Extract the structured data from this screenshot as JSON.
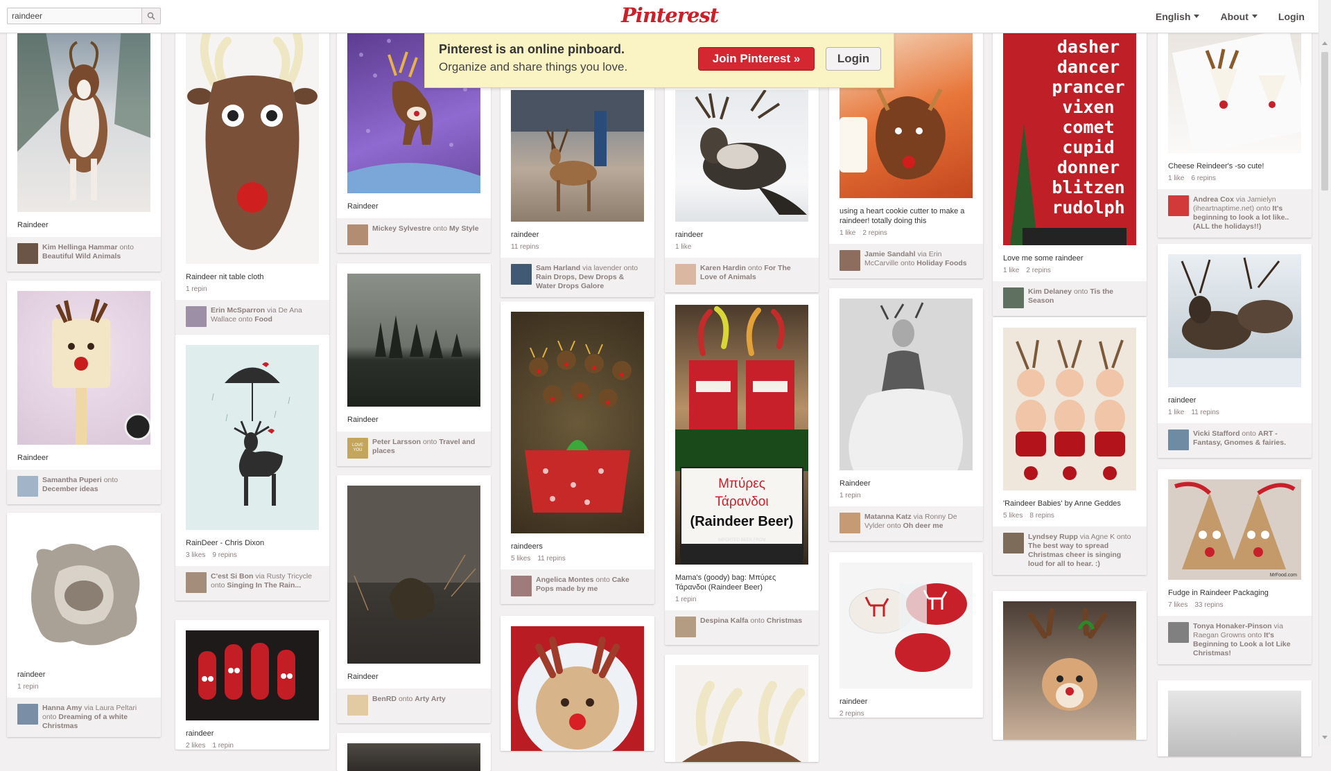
{
  "header": {
    "search_value": "raindeer",
    "logo": "Pinterest",
    "nav": [
      {
        "label": "English"
      },
      {
        "label": "About"
      },
      {
        "label": "Login"
      }
    ]
  },
  "banner": {
    "title": "Pinterest is an online pinboard.",
    "subtitle": "Organize and share things you love.",
    "join_label": "Join Pinterest »",
    "login_label": "Login"
  },
  "pins": [
    {
      "desc": "Raindeer",
      "stats": [],
      "user": "Kim Hellinga Hammar",
      "via": "",
      "onto_word": "onto",
      "board": "Beautiful Wild Animals"
    },
    {
      "desc": "Raindeer nit table cloth",
      "stats": [
        "1 repin"
      ],
      "user": "Erin McSparron",
      "via": "via De Ana Wallace",
      "onto_word": "onto",
      "board": "Food"
    },
    {
      "desc": "Raindeer",
      "stats": [],
      "user": "Mickey Sylvestre",
      "via": "",
      "onto_word": "onto",
      "board": "My Style"
    },
    {
      "desc": "raindeer",
      "stats": [
        "11 repins"
      ],
      "user": "Sam Harland",
      "via": "via lavender",
      "onto_word": "onto",
      "board": "Rain Drops, Dew Drops & Water Drops Galore"
    },
    {
      "desc": "raindeer",
      "stats": [
        "1 like"
      ],
      "user": "Karen Hardin",
      "via": "",
      "onto_word": "onto",
      "board": "For The Love of Animals"
    },
    {
      "desc": "using a heart cookie cutter to make a raindeer! totally doing this",
      "stats": [
        "1 like",
        "2 repins"
      ],
      "user": "Jamie Sandahl",
      "via": "via Erin McCarville",
      "onto_word": "onto",
      "board": "Holiday Foods"
    },
    {
      "desc": "Love me some raindeer",
      "stats": [
        "1 like",
        "2 repins"
      ],
      "user": "Kim Delaney",
      "via": "",
      "onto_word": "onto",
      "board": "Tis the Season"
    },
    {
      "desc": "Cheese Reindeer's -so cute!",
      "stats": [
        "1 like",
        "6 repins"
      ],
      "user": "Andrea Cox",
      "via": "via Jamielyn (iheartnaptime.net)",
      "onto_word": "onto",
      "board": "It's beginning to look a lot like.. (ALL the holidays!!)"
    },
    {
      "desc": "Raindeer",
      "stats": [],
      "user": "Samantha Puperi",
      "via": "",
      "onto_word": "onto",
      "board": "December ideas"
    },
    {
      "desc": "RainDeer - Chris Dixon",
      "stats": [
        "3 likes",
        "9 repins"
      ],
      "user": "C'est Si Bon",
      "via": "via Rusty Tricycle",
      "onto_word": "onto",
      "board": "Singing In The Rain..."
    },
    {
      "desc": "Raindeer",
      "stats": [],
      "user": "Peter Larsson",
      "via": "",
      "onto_word": "onto",
      "board": "Travel and places"
    },
    {
      "desc": "raindeers",
      "stats": [
        "5 likes",
        "11 repins"
      ],
      "user": "Angelica Montes",
      "via": "",
      "onto_word": "onto",
      "board": "Cake Pops made by me"
    },
    {
      "desc": "Mama's (goody) bag: Μπύρες Τάρανδοι (Raindeer Beer)",
      "stats": [
        "1 repin"
      ],
      "user": "Despina Kalfa",
      "via": "",
      "onto_word": "onto",
      "board": "Christmas"
    },
    {
      "desc": "Raindeer",
      "stats": [
        "1 repin"
      ],
      "user": "Matanna Katz",
      "via": "via Ronny De Vylder",
      "onto_word": "onto",
      "board": "Oh deer me"
    },
    {
      "desc": "'Raindeer Babies' by Anne Geddes",
      "stats": [
        "5 likes",
        "8 repins"
      ],
      "user": "Lyndsey Rupp",
      "via": "via Agne K",
      "onto_word": "onto",
      "board": "The best way to spread Christmas cheer is singing loud for all to hear. :)"
    },
    {
      "desc": "raindeer",
      "stats": [
        "1 like",
        "11 repins"
      ],
      "user": "Vicki Stafford",
      "via": "",
      "onto_word": "onto",
      "board": "ART - Fantasy, Gnomes & fairies."
    },
    {
      "desc": "raindeer",
      "stats": [
        "1 repin"
      ],
      "user": "Hanna Amy",
      "via": "via Laura Peltari",
      "onto_word": "onto",
      "board": "Dreaming of a white Christmas"
    },
    {
      "desc": "raindeer",
      "stats": [
        "2 likes",
        "1 repin"
      ],
      "user": "",
      "via": "",
      "onto_word": "",
      "board": ""
    },
    {
      "desc": "Raindeer",
      "stats": [],
      "user": "BenRD",
      "via": "",
      "onto_word": "onto",
      "board": "Arty Arty"
    },
    {
      "desc": "raindeer",
      "stats": [
        "2 repins"
      ],
      "user": "",
      "via": "",
      "onto_word": "",
      "board": ""
    },
    {
      "desc": "Fudge in Raindeer Packaging",
      "stats": [
        "7 likes",
        "33 repins"
      ],
      "user": "Tonya Honaker-Pinson",
      "via": "via Raegan Growns",
      "onto_word": "onto",
      "board": "It's Beginning to Look a lot Like Christmas!"
    }
  ],
  "images": {
    "poster_lines": [
      "dasher",
      "dancer",
      "prancer",
      "vixen",
      "comet",
      "cupid",
      "donner",
      "blitzen",
      "rudolph"
    ],
    "beer_label": [
      "Μπύρες",
      "Τάρανδοι",
      "(Raindeer Beer)"
    ],
    "beer_small": "IMPORTED BEER FROM",
    "love_thumb": "LOVE\nYOU",
    "mr_food": "MrFood.com"
  },
  "colors": {
    "brand": "#cb2027",
    "join": "#d52732",
    "banner_bg": "#faf3c4",
    "page_bg": "#f2f0f0"
  }
}
